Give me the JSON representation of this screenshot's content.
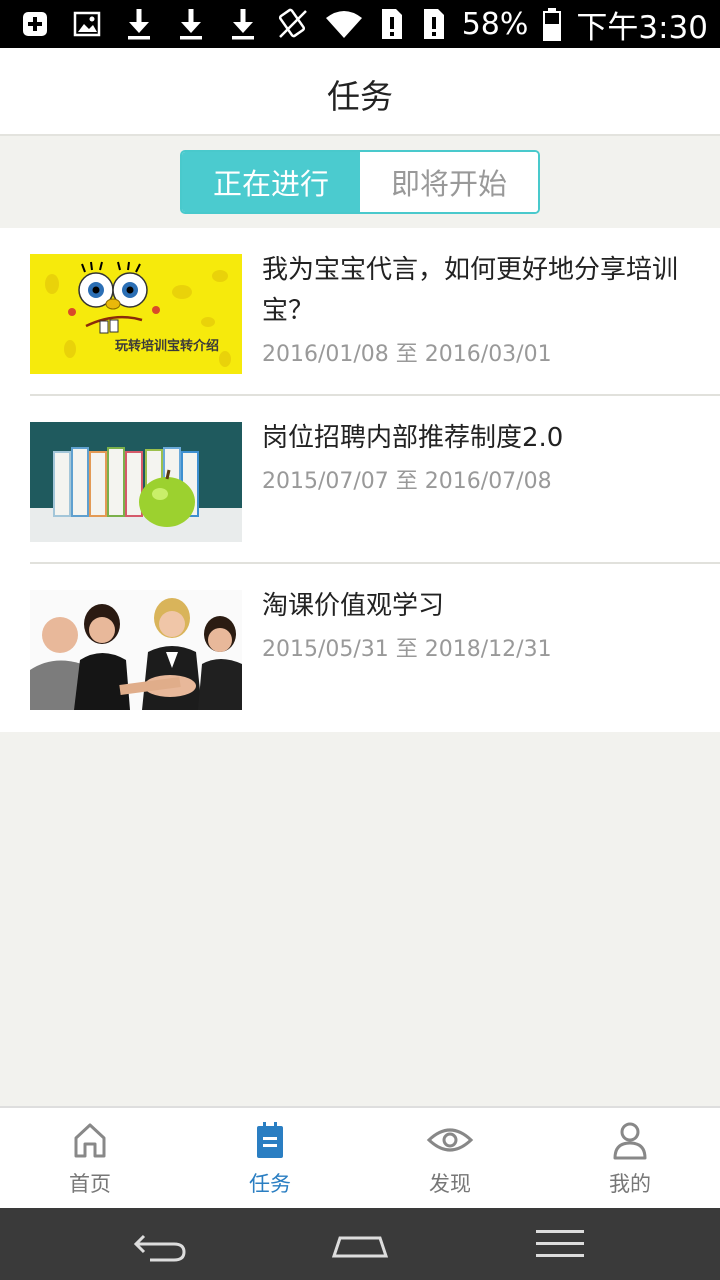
{
  "status_bar": {
    "battery": "58%",
    "time": "下午3:30",
    "left_icons": [
      "add-box-icon",
      "image-icon",
      "download-icon",
      "download-icon",
      "download-icon"
    ],
    "right_icons": [
      "rotate-icon",
      "wifi-icon",
      "sim-alert-icon",
      "sim-alert-icon",
      "battery-icon"
    ]
  },
  "header": {
    "title": "任务"
  },
  "segment": {
    "tabs": [
      {
        "label": "正在进行",
        "active": true
      },
      {
        "label": "即将开始",
        "active": false
      }
    ]
  },
  "tasks": [
    {
      "title": "我为宝宝代言，如何更好地分享培训宝？",
      "date": "2016/01/08 至 2016/03/01",
      "thumb_caption": "玩转培训宝转介绍",
      "thumb_icon": "spongebob-image"
    },
    {
      "title": "岗位招聘内部推荐制度2.0",
      "date": "2015/07/07 至 2016/07/08",
      "thumb_icon": "books-apple-image"
    },
    {
      "title": "淘课价值观学习",
      "date": "2015/05/31 至 2018/12/31",
      "thumb_icon": "team-hands-image"
    }
  ],
  "tabbar": {
    "items": [
      {
        "label": "首页",
        "icon": "home-icon",
        "active": false
      },
      {
        "label": "任务",
        "icon": "task-icon",
        "active": true
      },
      {
        "label": "发现",
        "icon": "eye-icon",
        "active": false
      },
      {
        "label": "我的",
        "icon": "person-icon",
        "active": false
      }
    ]
  },
  "colors": {
    "accent": "#4bcbcf",
    "active_tab": "#2a7ec2",
    "background": "#f2f2ee"
  }
}
